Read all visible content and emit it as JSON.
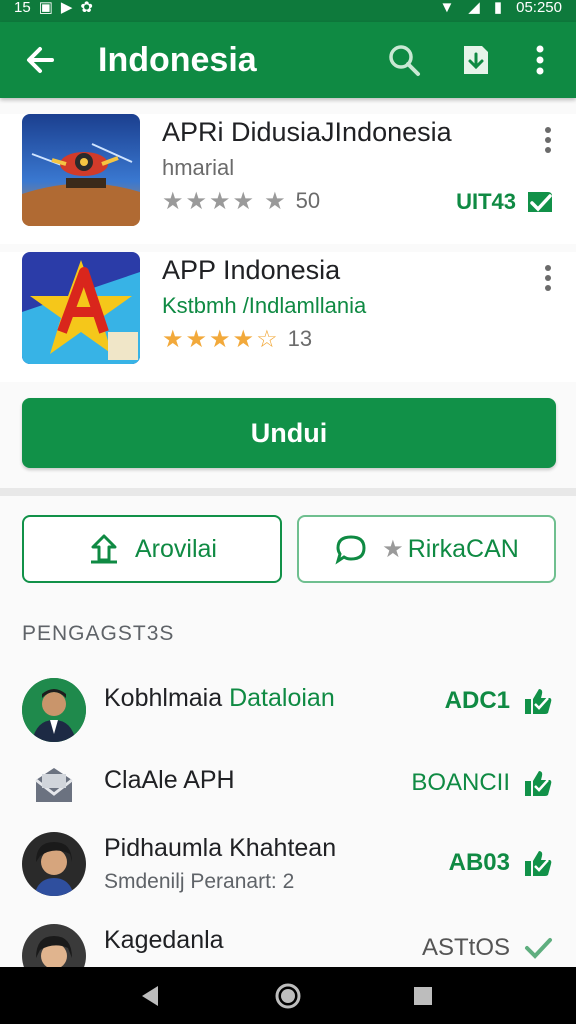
{
  "status_bar": {
    "left_icons": [
      "notification-icon",
      "image-icon",
      "play-icon",
      "settings-icon"
    ],
    "left_text": "15",
    "time": "05:250"
  },
  "appbar": {
    "title": "Indonesia"
  },
  "apps": [
    {
      "name": "APRi DidusiaJIndonesia",
      "subtitle": "hmarial",
      "rating_count": "50",
      "badge": "UIT43",
      "rating_fraction": 0.8,
      "thumb_icon": "robot-game-icon"
    },
    {
      "name": "APP Indonesia",
      "subtitle": "Kstbmh /Indlamllania",
      "rating_count": "13",
      "rating_fraction": 0.7,
      "thumb_icon": "star-logo-icon"
    }
  ],
  "download_label": "Undui",
  "actions": {
    "share_label": "Arovilai",
    "feedback_label": "RirkaCAN"
  },
  "section_title": "PENGAGST3S",
  "developers": [
    {
      "name": "Kobhlmaia",
      "name_highlight": "Dataloian",
      "subtitle": "",
      "badge": "ADC1",
      "badge_muted": false,
      "avatar": "man-portrait"
    },
    {
      "name": "ClaAle APH",
      "name_highlight": "",
      "subtitle": "",
      "badge": "BOANCII",
      "badge_muted": false,
      "avatar": "mail-icon"
    },
    {
      "name": "Pidhaumla Khahtean",
      "name_highlight": "",
      "subtitle": "Smdenilj Peranart: 2",
      "badge": "AB03",
      "badge_muted": false,
      "avatar": "woman-portrait"
    },
    {
      "name": "Kagedanla",
      "name_highlight": "",
      "subtitle": "",
      "badge": "ASTtOS",
      "badge_muted": true,
      "avatar": "woman-portrait-2"
    }
  ],
  "colors": {
    "primary": "#0f8a43",
    "primary_dark": "#0e7a3c",
    "star_gold": "#f2a93b",
    "star_grey": "#9a9a9a"
  }
}
